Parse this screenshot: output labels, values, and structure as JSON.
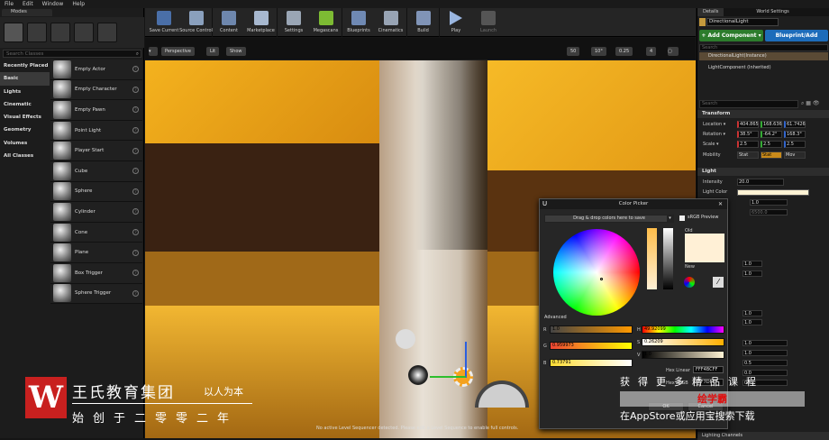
{
  "menu": [
    "File",
    "Edit",
    "Window",
    "Help"
  ],
  "modes": {
    "tab": "Modes",
    "search_placeholder": "Search Classes",
    "categories": [
      "Recently Placed",
      "Basic",
      "Lights",
      "Cinematic",
      "Visual Effects",
      "Geometry",
      "Volumes",
      "All Classes"
    ],
    "items": [
      "Empty Actor",
      "Empty Character",
      "Empty Pawn",
      "Point Light",
      "Player Start",
      "Cube",
      "Sphere",
      "Cylinder",
      "Cone",
      "Plane",
      "Box Trigger",
      "Sphere Trigger"
    ]
  },
  "toolbar": [
    "Save Current",
    "Source Control",
    "Content",
    "Marketplace",
    "Settings",
    "Megascans",
    "Blueprints",
    "Cinematics",
    "Build",
    "Play",
    "Launch"
  ],
  "viewport": {
    "perspective": "Perspective",
    "lit": "Lit",
    "show": "Show",
    "snap_value": "50",
    "rot_value": "10°",
    "scale_value": "0.25",
    "cam_speed": "4",
    "message": "No active Level Sequencer detected. Please edit a Level Sequence to enable full controls."
  },
  "details": {
    "tabs": [
      "Details",
      "World Settings"
    ],
    "name": "DirectionalLight",
    "add_component": "+ Add Component ▾",
    "blueprint": "Blueprint/Add",
    "search_placeholder": "Search",
    "components": [
      "DirectionalLight(Instance)",
      "LightComponent (Inherited)"
    ],
    "search2_placeholder": "Search",
    "transform_header": "Transform",
    "location_label": "Location ▾",
    "location": [
      "404.865",
      "168.636",
      "61.7426"
    ],
    "rotation_label": "Rotation ▾",
    "rotation": [
      "38.5°",
      "-64.2°",
      "168.3°"
    ],
    "scale_label": "Scale ▾",
    "scale": [
      "2.5",
      "2.5",
      "2.5"
    ],
    "mobility_label": "Mobility",
    "mobility": [
      "Stat",
      "Stat",
      "Mov"
    ],
    "light_header": "Light",
    "intensity_label": "Intensity",
    "intensity": "20.0",
    "lightcolor_label": "Light Color",
    "props": [
      "1.0",
      "6500.0",
      "1.0",
      "1.0",
      "1.0",
      "1.0",
      "1.0",
      "1.0",
      "0.5",
      "0.0",
      "0.0"
    ],
    "lighting_channels": "Lighting Channels"
  },
  "color_picker": {
    "title": "Color Picker",
    "drag_label": "Drag & drop colors here to save",
    "srgb": "sRGB Preview",
    "old_label": "Old",
    "new_label": "New",
    "advanced": "Advanced",
    "r_label": "R",
    "r": "1.0",
    "g_label": "G",
    "g": "0.959973",
    "b_label": "B",
    "b": "0.73791",
    "h_label": "H",
    "h": "49.92099",
    "s_label": "S",
    "s": "0.26209",
    "v_label": "V",
    "v": "1.0",
    "hex_linear_label": "Hex Linear",
    "hex_linear": "FFF4BCFF",
    "hex_srgb_label": "Hex sRGB",
    "hex_srgb": "FFF7DFFF",
    "ok": "OK",
    "cancel": "Cancel"
  },
  "watermark": {
    "brand": "王氏教育集团",
    "slogan": "以人为本",
    "founded": "始创于二零零二年",
    "promo1": "获得更多精品课程",
    "promo2": "绘学霸",
    "promo3": "在AppStore或应用宝搜索下载"
  }
}
